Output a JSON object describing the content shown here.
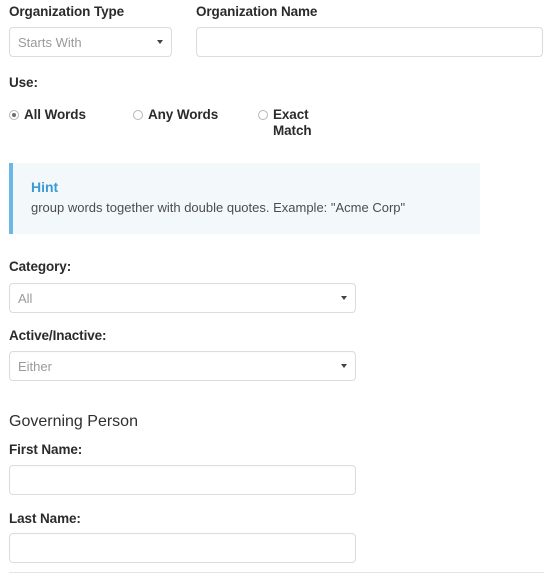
{
  "form": {
    "organization_type": {
      "label": "Organization Type",
      "selected": "Starts With"
    },
    "organization_name": {
      "label": "Organization Name",
      "value": "",
      "placeholder": ""
    },
    "use": {
      "label": "Use:",
      "options": [
        {
          "label": "All Words",
          "checked": true
        },
        {
          "label": "Any Words",
          "checked": false
        },
        {
          "label": "Exact Match",
          "checked": false
        }
      ]
    },
    "hint": {
      "title": "Hint",
      "text": "group words together with double quotes. Example: \"Acme Corp\"",
      "accent_color": "#6cb8e4",
      "background_color": "#f3f8fb",
      "title_color": "#3d9bd4"
    },
    "category": {
      "label": "Category:",
      "selected": "All"
    },
    "active_inactive": {
      "label": "Active/Inactive:",
      "selected": "Either"
    },
    "governing_person": {
      "heading": "Governing Person",
      "first_name": {
        "label": "First Name:",
        "value": "",
        "placeholder": ""
      },
      "last_name": {
        "label": "Last Name:",
        "value": "",
        "placeholder": ""
      }
    }
  }
}
